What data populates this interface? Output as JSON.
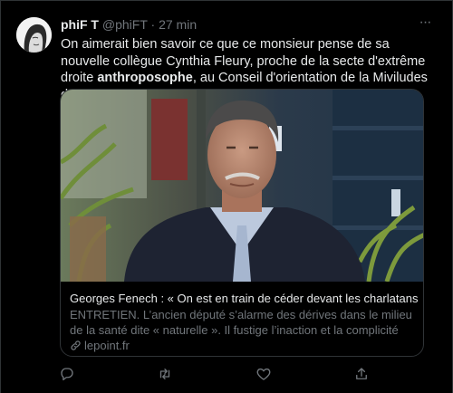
{
  "tweet": {
    "author_name": "phiF T",
    "handle": "@phiFT",
    "separator": "·",
    "time": "27 min",
    "more_label": "···",
    "text_part1": "On aimerait bien savoir ce que ce monsieur pense de sa nouvelle collègue Cynthia Fleury, proche de la secte d'extrême droite ",
    "text_bold": "anthroposophe",
    "text_part2": ", au Conseil d'orientation de la Miviludes de Schiappa."
  },
  "card": {
    "title": "Georges Fenech : « On est en train de céder devant les charlatans »",
    "description": "ENTRETIEN. L’ancien député s’alarme des dérives dans le milieu de la santé dite « naturelle ». Il fustige l’inaction et la complicité des ...",
    "domain": "lepoint.fr"
  },
  "actions": {
    "icons": [
      "reply-icon",
      "retweet-icon",
      "like-icon",
      "share-icon"
    ]
  },
  "colors": {
    "background": "#000000",
    "text_primary": "#e7e9ea",
    "text_secondary": "#71767b",
    "border": "#2f3336"
  }
}
